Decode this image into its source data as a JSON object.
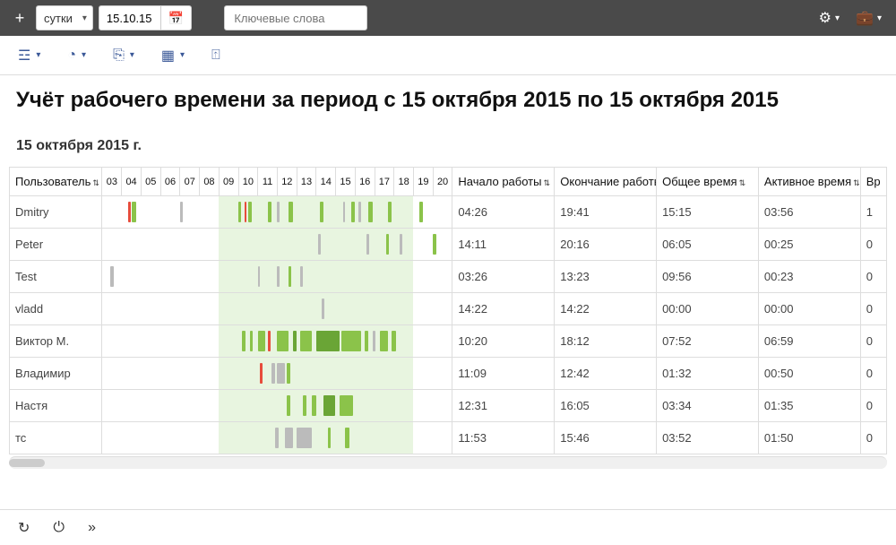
{
  "topbar": {
    "period_select": "сутки",
    "date_value": "15.10.15",
    "search_placeholder": "Ключевые слова"
  },
  "title": "Учёт рабочего времени за период с 15 октября 2015 по 15 октября 2015",
  "date_header": "15 октября 2015 г.",
  "columns": {
    "user": "Пользователь",
    "start": "Начало работы",
    "end": "Окончание работы",
    "total": "Общее время",
    "active": "Активное время",
    "last": "Вр"
  },
  "hours": [
    "03",
    "04",
    "05",
    "06",
    "07",
    "08",
    "09",
    "10",
    "11",
    "12",
    "13",
    "14",
    "15",
    "16",
    "17",
    "18",
    "19",
    "20"
  ],
  "hour_base": 3,
  "hour_count": 18,
  "avail_start": 9,
  "avail_end": 19,
  "rows": [
    {
      "user": "Dmitry",
      "start": "04:26",
      "end": "19:41",
      "total": "15:15",
      "active": "03:56",
      "extra": "1",
      "segs": [
        {
          "h": 4.3,
          "w": 0.15,
          "c": "red"
        },
        {
          "h": 4.5,
          "w": 0.25,
          "c": "green"
        },
        {
          "h": 7.0,
          "w": 0.12,
          "c": "gray"
        },
        {
          "h": 10.0,
          "w": 0.15,
          "c": "green"
        },
        {
          "h": 10.3,
          "w": 0.1,
          "c": "red"
        },
        {
          "h": 10.5,
          "w": 0.2,
          "c": "green"
        },
        {
          "h": 11.5,
          "w": 0.2,
          "c": "green"
        },
        {
          "h": 12.0,
          "w": 0.1,
          "c": "gray"
        },
        {
          "h": 12.6,
          "w": 0.2,
          "c": "green"
        },
        {
          "h": 14.2,
          "w": 0.2,
          "c": "green"
        },
        {
          "h": 15.4,
          "w": 0.1,
          "c": "gray"
        },
        {
          "h": 15.8,
          "w": 0.2,
          "c": "green"
        },
        {
          "h": 16.2,
          "w": 0.1,
          "c": "gray"
        },
        {
          "h": 16.7,
          "w": 0.2,
          "c": "green"
        },
        {
          "h": 17.7,
          "w": 0.2,
          "c": "green"
        },
        {
          "h": 19.3,
          "w": 0.2,
          "c": "green"
        }
      ]
    },
    {
      "user": "Peter",
      "start": "14:11",
      "end": "20:16",
      "total": "06:05",
      "active": "00:25",
      "extra": "0",
      "segs": [
        {
          "h": 14.1,
          "w": 0.15,
          "c": "gray"
        },
        {
          "h": 16.6,
          "w": 0.15,
          "c": "gray"
        },
        {
          "h": 17.6,
          "w": 0.15,
          "c": "green"
        },
        {
          "h": 18.3,
          "w": 0.15,
          "c": "gray"
        },
        {
          "h": 20.0,
          "w": 0.2,
          "c": "green"
        }
      ]
    },
    {
      "user": "Test",
      "start": "03:26",
      "end": "13:23",
      "total": "09:56",
      "active": "00:23",
      "extra": "0",
      "segs": [
        {
          "h": 3.4,
          "w": 0.2,
          "c": "gray"
        },
        {
          "h": 11.0,
          "w": 0.12,
          "c": "gray"
        },
        {
          "h": 12.0,
          "w": 0.12,
          "c": "gray"
        },
        {
          "h": 12.6,
          "w": 0.12,
          "c": "green"
        },
        {
          "h": 13.2,
          "w": 0.12,
          "c": "gray"
        }
      ]
    },
    {
      "user": "vladd",
      "start": "14:22",
      "end": "14:22",
      "total": "00:00",
      "active": "00:00",
      "extra": "0",
      "segs": [
        {
          "h": 14.3,
          "w": 0.12,
          "c": "gray"
        }
      ]
    },
    {
      "user": "Виктор М.",
      "start": "10:20",
      "end": "18:12",
      "total": "07:52",
      "active": "06:59",
      "extra": "0",
      "segs": [
        {
          "h": 10.2,
          "w": 0.15,
          "c": "green"
        },
        {
          "h": 10.6,
          "w": 0.15,
          "c": "green"
        },
        {
          "h": 11.0,
          "w": 0.4,
          "c": "green"
        },
        {
          "h": 11.5,
          "w": 0.15,
          "c": "red"
        },
        {
          "h": 12.0,
          "w": 0.6,
          "c": "green"
        },
        {
          "h": 12.8,
          "w": 0.2,
          "c": "dgreen"
        },
        {
          "h": 13.2,
          "w": 0.6,
          "c": "green"
        },
        {
          "h": 14.0,
          "w": 1.2,
          "c": "dgreen"
        },
        {
          "h": 15.3,
          "w": 1.0,
          "c": "green"
        },
        {
          "h": 16.5,
          "w": 0.2,
          "c": "green"
        },
        {
          "h": 16.9,
          "w": 0.15,
          "c": "gray"
        },
        {
          "h": 17.3,
          "w": 0.4,
          "c": "green"
        },
        {
          "h": 17.9,
          "w": 0.2,
          "c": "green"
        }
      ]
    },
    {
      "user": "Владимир",
      "start": "11:09",
      "end": "12:42",
      "total": "01:32",
      "active": "00:50",
      "extra": "0",
      "segs": [
        {
          "h": 11.1,
          "w": 0.15,
          "c": "red"
        },
        {
          "h": 11.7,
          "w": 0.2,
          "c": "gray"
        },
        {
          "h": 12.0,
          "w": 0.4,
          "c": "gray"
        },
        {
          "h": 12.5,
          "w": 0.15,
          "c": "green"
        }
      ]
    },
    {
      "user": "Настя",
      "start": "12:31",
      "end": "16:05",
      "total": "03:34",
      "active": "01:35",
      "extra": "0",
      "segs": [
        {
          "h": 12.5,
          "w": 0.15,
          "c": "green"
        },
        {
          "h": 13.3,
          "w": 0.2,
          "c": "green"
        },
        {
          "h": 13.8,
          "w": 0.2,
          "c": "green"
        },
        {
          "h": 14.4,
          "w": 0.6,
          "c": "dgreen"
        },
        {
          "h": 15.2,
          "w": 0.7,
          "c": "green"
        }
      ]
    },
    {
      "user": "тс",
      "start": "11:53",
      "end": "15:46",
      "total": "03:52",
      "active": "01:50",
      "extra": "0",
      "segs": [
        {
          "h": 11.9,
          "w": 0.15,
          "c": "gray"
        },
        {
          "h": 12.4,
          "w": 0.4,
          "c": "gray"
        },
        {
          "h": 13.0,
          "w": 0.8,
          "c": "gray"
        },
        {
          "h": 14.6,
          "w": 0.15,
          "c": "green"
        },
        {
          "h": 15.5,
          "w": 0.2,
          "c": "green"
        }
      ]
    }
  ]
}
